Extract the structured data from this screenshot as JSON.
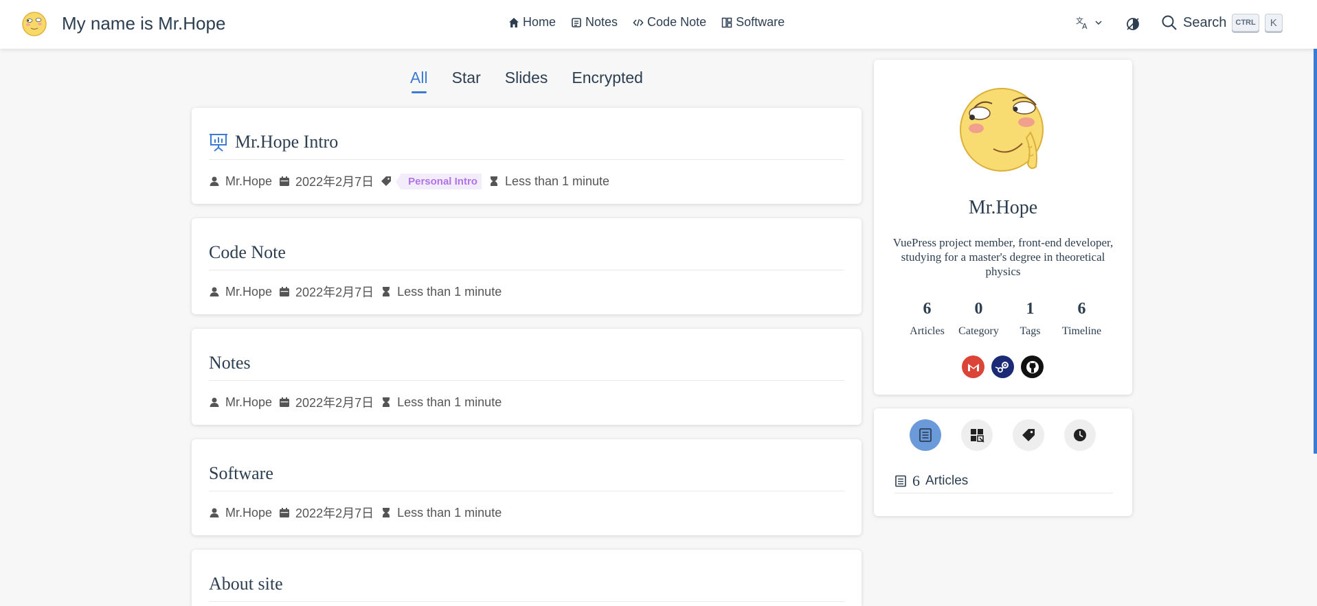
{
  "header": {
    "site_name": "My name is Mr.Hope",
    "nav": [
      {
        "label": "Home",
        "icon": "home-icon"
      },
      {
        "label": "Notes",
        "icon": "notes-icon"
      },
      {
        "label": "Code Note",
        "icon": "code-icon"
      },
      {
        "label": "Software",
        "icon": "software-icon"
      }
    ],
    "search_label": "Search",
    "shortcut_keys": [
      "CTRL",
      "K"
    ]
  },
  "tabs": [
    {
      "label": "All",
      "active": true
    },
    {
      "label": "Star",
      "active": false
    },
    {
      "label": "Slides",
      "active": false
    },
    {
      "label": "Encrypted",
      "active": false
    }
  ],
  "articles": [
    {
      "title": "Mr.Hope Intro",
      "author": "Mr.Hope",
      "date": "2022年2月7日",
      "tag": "Personal Intro",
      "reading_time": "Less than 1 minute",
      "icon": "slides-icon"
    },
    {
      "title": "Code Note",
      "author": "Mr.Hope",
      "date": "2022年2月7日",
      "reading_time": "Less than 1 minute"
    },
    {
      "title": "Notes",
      "author": "Mr.Hope",
      "date": "2022年2月7日",
      "reading_time": "Less than 1 minute"
    },
    {
      "title": "Software",
      "author": "Mr.Hope",
      "date": "2022年2月7日",
      "reading_time": "Less than 1 minute"
    },
    {
      "title": "About site"
    }
  ],
  "profile": {
    "name": "Mr.Hope",
    "description": "VuePress project member, front-end developer, studying for a master's degree in theoretical physics",
    "stats": [
      {
        "value": "6",
        "label": "Articles"
      },
      {
        "value": "0",
        "label": "Category"
      },
      {
        "value": "1",
        "label": "Tags"
      },
      {
        "value": "6",
        "label": "Timeline"
      }
    ],
    "socials": [
      {
        "name": "gmail-icon",
        "color": "#db4437"
      },
      {
        "name": "steam-icon",
        "color": "#1b2a75"
      },
      {
        "name": "github-icon",
        "color": "#111111"
      }
    ]
  },
  "info_panel": {
    "buttons": [
      "article-list-icon",
      "category-icon",
      "tag-icon",
      "timeline-icon"
    ],
    "active_button": "article-list-icon",
    "count": "6",
    "label": "Articles"
  },
  "colors": {
    "accent": "#3b7bd4",
    "tag_text": "#b074e6",
    "tag_bg": "#f3ecfb"
  }
}
